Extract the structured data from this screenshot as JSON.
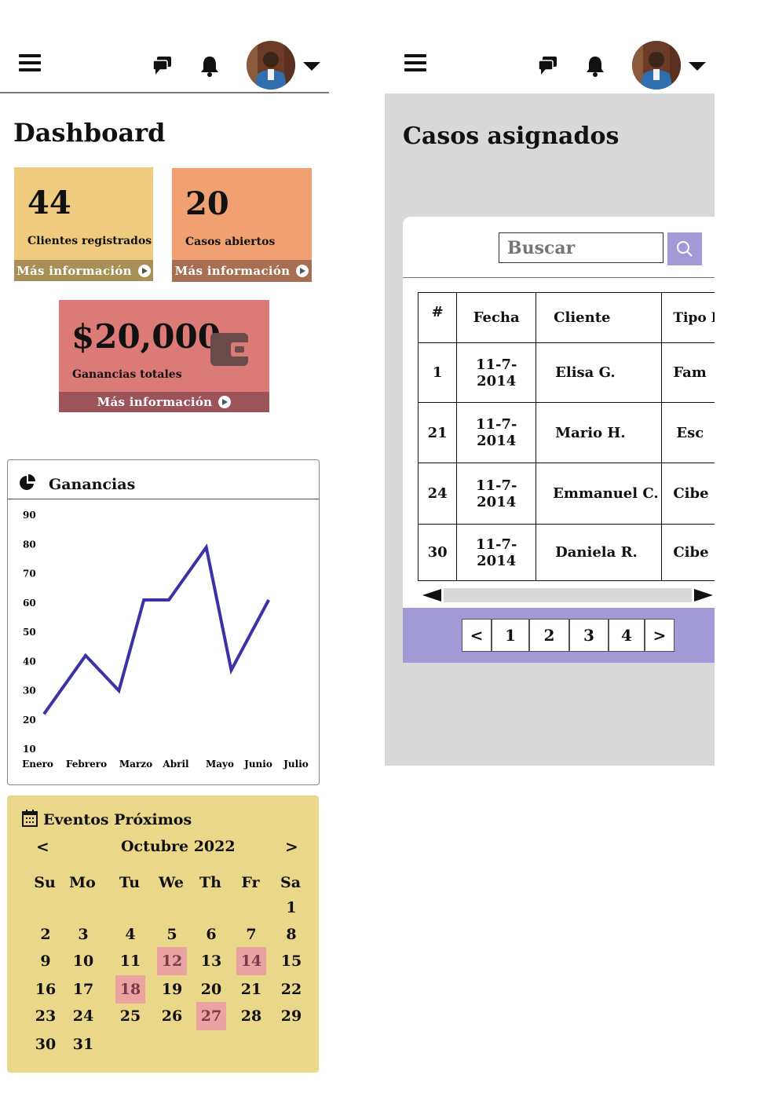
{
  "left": {
    "title": "Dashboard",
    "cards": [
      {
        "value": "44",
        "label": "Clientes registrados",
        "more": "Más información"
      },
      {
        "value": "20",
        "label": "Casos abiertos",
        "more": "Más información"
      },
      {
        "value": "$20,000",
        "label": "Ganancias totales",
        "more": "Más información"
      }
    ],
    "chart_title": "Ganancias",
    "calendar": {
      "title": "Eventos Próximos",
      "prev": "<",
      "next": ">",
      "month": "Octubre 2022",
      "weekdays": [
        "Su",
        "Mo",
        "Tu",
        "We",
        "Th",
        "Fr",
        "Sa"
      ],
      "highlight_color": "#eaa3a1"
    }
  },
  "right": {
    "title": "Casos asignados",
    "search_placeholder": "Buscar",
    "table": {
      "headers": [
        "#",
        "Fecha",
        "Cliente",
        "Tipo Dem"
      ],
      "rows": [
        [
          "1",
          "11-7-2014",
          "Elisa G.",
          "Fam"
        ],
        [
          "21",
          "11-7-2014",
          "Mario H.",
          "Esc"
        ],
        [
          "24",
          "11-7-2014",
          "Emmanuel C.",
          "Cibe"
        ],
        [
          "30",
          "11-7-2014",
          "Daniela R.",
          "Cibe"
        ]
      ]
    },
    "pagination": [
      "<",
      "1",
      "2",
      "3",
      "4",
      ">"
    ]
  },
  "colors": {
    "card1": "#eecb7e",
    "card1_footer": "#a88f56",
    "card2": "#f0a071",
    "card2_footer": "#a86e52",
    "card3": "#dc7a77",
    "card3_footer": "#9c5458",
    "line": "#3b32a8",
    "calendar_bg": "#ebd78a",
    "panel_bg": "#d9d9d9",
    "pagination_bg": "#a29ad6"
  },
  "chart_data": {
    "type": "line",
    "categories": [
      "Enero",
      "Febrero",
      "Marzo",
      "Abril",
      "Mayo",
      "Junio",
      "Julio"
    ],
    "x_points": [
      0,
      1,
      1.8,
      2.4,
      3,
      3.9,
      4.5,
      5.4,
      6
    ],
    "values": [
      22,
      42,
      30,
      61,
      61,
      79,
      37,
      61
    ],
    "ylim": [
      10,
      90
    ],
    "yticks": [
      10,
      20,
      30,
      40,
      50,
      60,
      70,
      80,
      90
    ],
    "title": "Ganancias"
  }
}
